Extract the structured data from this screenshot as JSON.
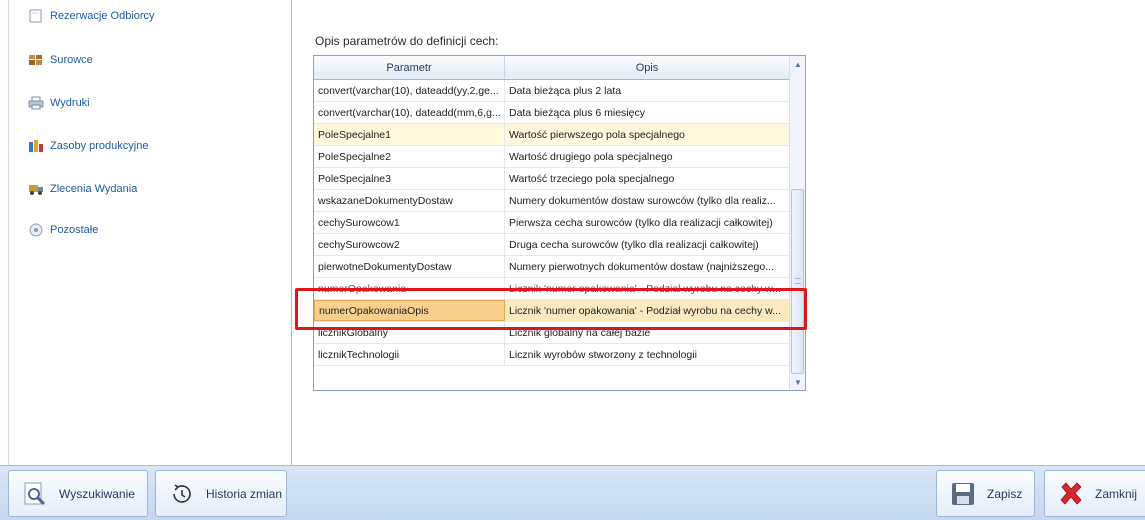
{
  "sidebar": {
    "items": [
      {
        "label": "Rezerwacje Odbiorcy",
        "icon": "reservation-icon"
      },
      {
        "label": "Surowce",
        "icon": "materials-icon"
      },
      {
        "label": "Wydruki",
        "icon": "printer-icon"
      },
      {
        "label": "Zasoby produkcyjne",
        "icon": "production-resources-icon"
      },
      {
        "label": "Zlecenia Wydania",
        "icon": "truck-icon"
      },
      {
        "label": "Pozostałe",
        "icon": "other-icon"
      }
    ]
  },
  "main": {
    "section_label": "Opis parametrów do definicji cech:",
    "grid": {
      "columns": [
        "Parametr",
        "Opis"
      ],
      "rows": [
        {
          "param": "convert(varchar(10), dateadd(yy,2,ge...",
          "desc": "Data bieżąca plus 2 lata"
        },
        {
          "param": "convert(varchar(10), dateadd(mm,6,g...",
          "desc": "Data bieżąca plus 6 miesięcy"
        },
        {
          "param": "PoleSpecjalne1",
          "desc": "Wartość pierwszego pola specjalnego"
        },
        {
          "param": "PoleSpecjalne2",
          "desc": "Wartość drugiego pola specjalnego"
        },
        {
          "param": "PoleSpecjalne3",
          "desc": "Wartość trzeciego pola specjalnego"
        },
        {
          "param": "wskazaneDokumentyDostaw",
          "desc": "Numery dokumentów dostaw surowców (tylko dla realiz..."
        },
        {
          "param": "cechySurowcow1",
          "desc": "Pierwsza cecha surowców (tylko dla realizacji całkowitej)"
        },
        {
          "param": "cechySurowcow2",
          "desc": "Druga cecha surowców (tylko dla realizacji całkowitej)"
        },
        {
          "param": "pierwotneDokumentyDostaw",
          "desc": "Numery pierwotnych dokumentów dostaw (najniższego..."
        },
        {
          "param": "numerOpakowania",
          "desc": "Licznik 'numer opakowania' - Podział wyrobu na cechy w..."
        },
        {
          "param": "numerOpakowaniaOpis",
          "desc": "Licznik 'numer opakowania' - Podział wyrobu na cechy w..."
        },
        {
          "param": "licznikGlobalny",
          "desc": "Licznik globalny na całej bazie"
        },
        {
          "param": "licznikTechnologii",
          "desc": "Licznik wyrobów stworzony z technologii"
        }
      ]
    }
  },
  "toolbar": {
    "search_label": "Wyszukiwanie",
    "history_label": "Historia zmian",
    "save_label": "Zapisz",
    "close_label": "Zamknij"
  },
  "colors": {
    "highlight_row": "#fff8dc",
    "selected_row": "#fde9bf",
    "annotation_red": "#e0151b",
    "nav_text": "#1e5aa0"
  }
}
